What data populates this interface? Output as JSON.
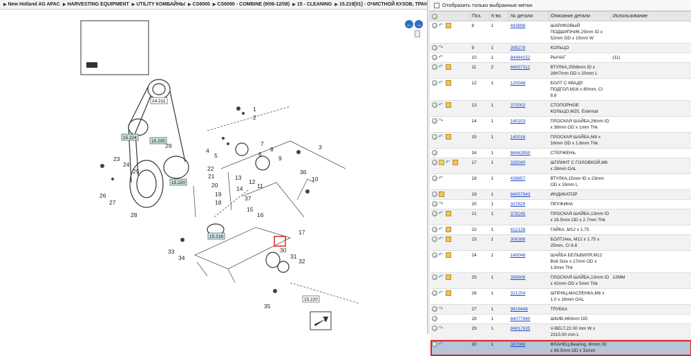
{
  "breadcrumb": [
    "New Holland AG APAC",
    "HARVESTING EQUIPMENT",
    "UTILITY КОМБАЙНЫ",
    "CS6000",
    "CS6090 - COMBINE (9/06-12/08)",
    "15 - CLEANING",
    "15.219[01] - ОЧИСТНОЙ КУЗОВ, ТРАНСМИ..."
  ],
  "filter": {
    "label": "Отобразить только выбранные метки"
  },
  "columns": {
    "pos": "Поз.",
    "qty": "К-во",
    "partno": "№ детали",
    "desc": "Описание детали",
    "usage": "Использование"
  },
  "rows": [
    {
      "pos": "8",
      "qty": "1",
      "partno": "443898",
      "desc": "ШАРИКОВЫЙ ПОДШИПНИК,25mm ID x 52mm OD x 15mm W",
      "usage": "",
      "icons": [
        "circle",
        "info",
        "box"
      ]
    },
    {
      "pos": "9",
      "qty": "1",
      "partno": "395278",
      "desc": "КОЛЬЦО",
      "usage": "",
      "icons": [
        "circle",
        "green"
      ]
    },
    {
      "pos": "10",
      "qty": "1",
      "partno": "84444152",
      "desc": "РЫЧАГ",
      "usage": "(11)",
      "icons": [
        "circle",
        "info"
      ]
    },
    {
      "pos": "11",
      "qty": "2",
      "partno": "84057311",
      "desc": "ВТУЛКА,25h8mm ID x 28H7mm OD x 20mm L",
      "usage": "",
      "icons": [
        "circle",
        "info",
        "box"
      ]
    },
    {
      "pos": "12",
      "qty": "1",
      "partno": "120048",
      "desc": "БОЛТ С КВАДР. ПОДГОЛ,M16 x 80mm, Cl 8.8",
      "usage": "",
      "icons": [
        "circle",
        "info",
        "box"
      ]
    },
    {
      "pos": "13",
      "qty": "1",
      "partno": "370002",
      "desc": "СТОПОРНОЕ КОЛЬЦО,M25, External",
      "usage": "",
      "icons": [
        "circle",
        "info",
        "box"
      ]
    },
    {
      "pos": "14",
      "qty": "1",
      "partno": "140103",
      "desc": "ПЛОСКАЯ ШАЙБА,26mm ID x 38mm OD x 1mm Thk",
      "usage": "",
      "icons": [
        "circle",
        "green"
      ]
    },
    {
      "pos": "15",
      "qty": "1",
      "partno": "140016",
      "desc": "ПЛОСКАЯ ШАЙБА,M8 x 16mm OD x 1.6mm Thk",
      "usage": "",
      "icons": [
        "circle",
        "info",
        "box"
      ]
    },
    {
      "pos": "16",
      "qty": "1",
      "partno": "84443950",
      "desc": "СТЕРЖЕНЬ",
      "usage": "",
      "icons": [
        "circle"
      ]
    },
    {
      "pos": "17",
      "qty": "1",
      "partno": "335040",
      "desc": "ШПЛИНТ С ГОЛОВКОЙ,M8 x 28mm OAL",
      "usage": "",
      "icons": [
        "circle",
        "folder",
        "info",
        "box"
      ]
    },
    {
      "pos": "18",
      "qty": "1",
      "partno": "439857",
      "desc": "ВТУЛКА,15mm ID x 23mm OD x 16mm L",
      "usage": "",
      "icons": [
        "circle",
        "info"
      ]
    },
    {
      "pos": "19",
      "qty": "1",
      "partno": "84057943",
      "desc": "ИНДИКАТОР",
      "usage": "",
      "icons": [
        "circle",
        "box"
      ]
    },
    {
      "pos": "20",
      "qty": "1",
      "partno": "337829",
      "desc": "ПРУЖИНА",
      "usage": "",
      "icons": [
        "circle",
        "green"
      ]
    },
    {
      "pos": "21",
      "qty": "1",
      "partno": "378245",
      "desc": "ПЛОСКАЯ ШАЙБА,13mm ID x 28.5mm OD x 2.7mm Thk",
      "usage": "",
      "icons": [
        "circle",
        "info",
        "box"
      ]
    },
    {
      "pos": "22",
      "qty": "1",
      "partno": "412126",
      "desc": "ГАЙКА ,M12 x 1.75",
      "usage": "",
      "icons": [
        "circle",
        "info",
        "box"
      ]
    },
    {
      "pos": "23",
      "qty": "1",
      "partno": "306388",
      "desc": "БОЛТ,Hex, M12 x 1.75 x 25mm, Cl 8.8",
      "usage": "",
      "icons": [
        "circle",
        "info",
        "box"
      ]
    },
    {
      "pos": "24",
      "qty": "1",
      "partno": "140046",
      "desc": "ШАЙБА БЕЛЬВИЛЯ,M12 Bolt Size x 27mm OD x 1.8mm Thk",
      "usage": "",
      "icons": [
        "circle",
        "info",
        "box"
      ]
    },
    {
      "pos": "25",
      "qty": "1",
      "partno": "395606",
      "desc": "ПЛОСКАЯ ШАЙБА,13mm ID x 42mm OD x 5mm Thk",
      "usage": "12MM",
      "icons": [
        "circle",
        "info",
        "box"
      ]
    },
    {
      "pos": "26",
      "qty": "1",
      "partno": "321204",
      "desc": "ШПРИЦ-МАСЛЕНКА,M6 x 1.0 x 16mm OAL",
      "usage": "",
      "icons": [
        "circle",
        "info",
        "box"
      ]
    },
    {
      "pos": "27",
      "qty": "1",
      "partno": "9818446",
      "desc": "ТРУБКА",
      "usage": "",
      "icons": [
        "circle",
        "green"
      ]
    },
    {
      "pos": "28",
      "qty": "1",
      "partno": "84077960",
      "desc": "ШКИВ,460mm OD",
      "usage": "",
      "icons": [
        "circle"
      ]
    },
    {
      "pos": "29",
      "qty": "1",
      "partno": "84817635",
      "desc": "V-BELT,22.00 mm W x 2315.00 mm L",
      "usage": "",
      "icons": [
        "circle",
        "green"
      ]
    },
    {
      "pos": "30",
      "qty": "1",
      "partno": "387566",
      "desc": "ФЛАНЕЦ,Bearing, 80mm ID x 99.5mm OD x 31mm",
      "usage": "",
      "icons": [
        "circle",
        "info"
      ],
      "selected": true
    }
  ],
  "callouts": [
    "1",
    "2",
    "3",
    "4",
    "5",
    "6",
    "7",
    "8",
    "9",
    "10",
    "11",
    "12",
    "13",
    "14",
    "15",
    "16",
    "17",
    "18",
    "19",
    "20",
    "21",
    "22",
    "23",
    "24",
    "25",
    "26",
    "27",
    "28",
    "29",
    "30",
    "31",
    "32",
    "33",
    "34",
    "35",
    "36",
    "37"
  ],
  "refs": [
    "14.211",
    "15.224",
    "15.205",
    "15.220",
    "15.218",
    "15.220"
  ]
}
